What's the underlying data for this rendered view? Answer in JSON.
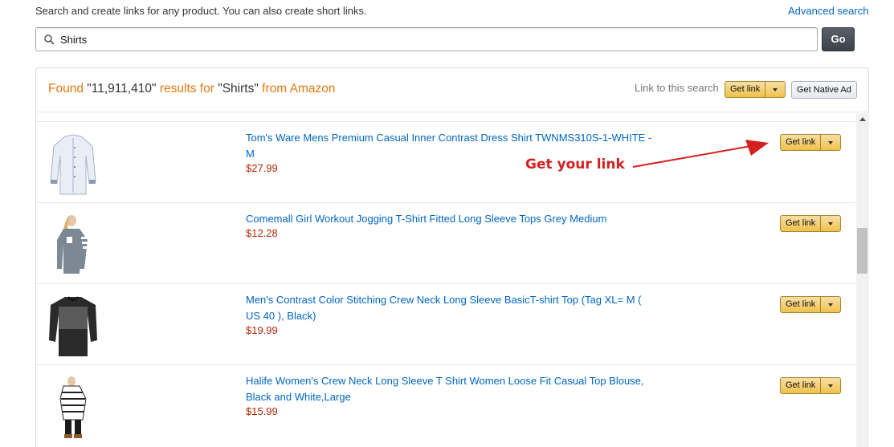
{
  "header": {
    "intro": "Search and create links for any product. You can also create short links.",
    "advanced_search": "Advanced search"
  },
  "search": {
    "value": "Shirts",
    "go_label": "Go"
  },
  "results_header": {
    "found_prefix": "Found ",
    "count": "\"11,911,410\"",
    "results_for": " results for ",
    "query": "\"Shirts\"",
    "source": " from Amazon",
    "link_to_search": "Link to this search",
    "get_link_label": "Get link",
    "native_ad_label": "Get Native Ad"
  },
  "products": [
    {
      "title": "Tom's Ware Mens Premium Casual Inner Contrast Dress Shirt TWNMS310S-1-WHITE -M",
      "price": "$27.99",
      "button": "Get link"
    },
    {
      "title": "Comemall Girl Workout Jogging T-Shirt Fitted Long Sleeve Tops Grey Medium",
      "price": "$12.28",
      "button": "Get link"
    },
    {
      "title": "Men's Contrast Color Stitching Crew Neck Long Sleeve BasicT-shirt Top (Tag XL= M ( US 40 ), Black)",
      "price": "$19.99",
      "button": "Get link"
    },
    {
      "title": "Halife Women's Crew Neck Long Sleeve T Shirt Women Loose Fit Casual Top Blouse, Black and White,Large",
      "price": "$15.99",
      "button": "Get link"
    }
  ],
  "annotation": {
    "text": "Get your link"
  },
  "icons": {
    "search": "search-icon",
    "dropdown": "caret-down-icon",
    "arrow": "red-arrow-icon"
  },
  "colors": {
    "link": "#0066c0",
    "price": "#b12704",
    "found": "#e47911",
    "button_yellow": "#f0c14b",
    "annotation": "#d42020"
  }
}
